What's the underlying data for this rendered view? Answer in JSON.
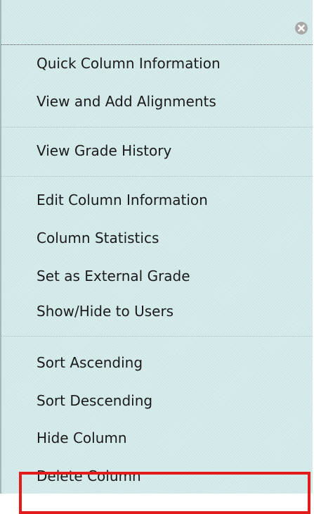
{
  "menu": {
    "close_icon": "close-icon",
    "sections": [
      {
        "items": [
          {
            "label": "Quick Column Information"
          },
          {
            "label": "View and Add Alignments"
          }
        ]
      },
      {
        "items": [
          {
            "label": "View Grade History"
          }
        ]
      },
      {
        "items": [
          {
            "label": "Edit Column Information"
          },
          {
            "label": "Column Statistics"
          },
          {
            "label": "Set as External Grade"
          },
          {
            "label": "Show/Hide to Users"
          }
        ]
      },
      {
        "items": [
          {
            "label": "Sort Ascending"
          },
          {
            "label": "Sort Descending"
          },
          {
            "label": "Hide Column"
          },
          {
            "label": "Delete Column"
          }
        ]
      }
    ]
  },
  "colors": {
    "menu_background": "#d3eaea",
    "highlight_border": "#e41b1b",
    "close_icon": "#a9a9a9"
  }
}
